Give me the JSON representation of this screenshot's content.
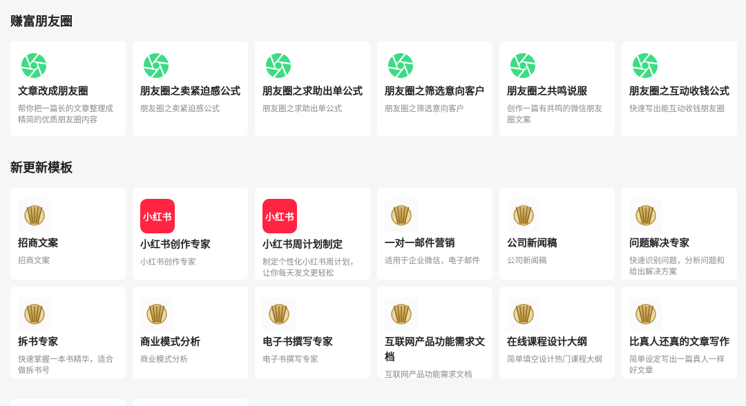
{
  "sections": [
    {
      "title": "赚富朋友圈"
    },
    {
      "title": "新更新模板"
    }
  ],
  "moments_cards": [
    {
      "title": "文章改成朋友圈",
      "desc": "帮你把一篇长的文章整理成精简的优质朋友圈内容",
      "icon": "aperture-icon"
    },
    {
      "title": "朋友圈之卖紧迫感公式",
      "desc": "朋友圈之卖紧迫感公式",
      "icon": "aperture-icon"
    },
    {
      "title": "朋友圈之求助出单公式",
      "desc": "朋友圈之求助出单公式",
      "icon": "aperture-icon"
    },
    {
      "title": "朋友圈之筛选意向客户",
      "desc": "朋友圈之筛选意向客户",
      "icon": "aperture-icon"
    },
    {
      "title": "朋友圈之共鸣说服",
      "desc": "创作一篇有共鸣的微信朋友圈文案",
      "icon": "aperture-icon"
    },
    {
      "title": "朋友圈之互动收钱公式",
      "desc": "快速写出能互动收钱朋友圈",
      "icon": "aperture-icon"
    }
  ],
  "template_cards": [
    {
      "title": "招商文案",
      "desc": "招商文案",
      "icon": "medal"
    },
    {
      "title": "小红书创作专家",
      "desc": "小红书创作专家",
      "icon": "xhs",
      "icon_text": "小红书"
    },
    {
      "title": "小红书周计划制定",
      "desc": "制定个性化小红书周计划，让你每天发文更轻松",
      "icon": "xhs",
      "icon_text": "小红书"
    },
    {
      "title": "一对一邮件营销",
      "desc": "适用于企业微信，电子邮件",
      "icon": "medal"
    },
    {
      "title": "公司新闻稿",
      "desc": "公司新闻稿",
      "icon": "medal"
    },
    {
      "title": "问题解决专家",
      "desc": "快速识别问题，分析问题和给出解决方案",
      "icon": "medal"
    },
    {
      "title": "拆书专家",
      "desc": "快速掌握一本书精华，适合做拆书号",
      "icon": "medal"
    },
    {
      "title": "商业模式分析",
      "desc": "商业模式分析",
      "icon": "medal"
    },
    {
      "title": "电子书撰写专家",
      "desc": "电子书撰写专家",
      "icon": "medal"
    },
    {
      "title": "互联网产品功能需求文档",
      "desc": "互联网产品功能需求文档",
      "icon": "medal"
    },
    {
      "title": "在线课程设计大纲",
      "desc": "简单填空设计热门课程大纲",
      "icon": "medal"
    },
    {
      "title": "比真人还真的文章写作",
      "desc": "简单设定写出一篇真人一样好文章",
      "icon": "medal"
    }
  ],
  "colors": {
    "aperture": "#3ddc84",
    "xhs": "#ff2442",
    "gold": "#b8923a"
  }
}
